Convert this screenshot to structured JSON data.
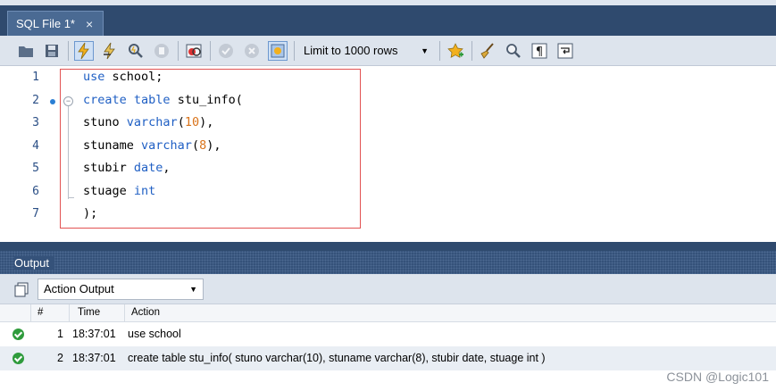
{
  "tab": {
    "title": "SQL File 1*",
    "close": "×"
  },
  "toolbar": {
    "icons": [
      "folder-icon",
      "save-icon",
      "execute-icon",
      "execute-current-icon",
      "explain-icon",
      "stop-icon",
      "toggle-error-icon",
      "commit-icon",
      "rollback-icon",
      "autocommit-icon"
    ],
    "limit_label": "Limit to 1000 rows",
    "limit_arrow": "▼",
    "right_icons": [
      "bookmark-star-icon",
      "beautify-broom-icon",
      "find-icon",
      "invisible-chars-icon",
      "word-wrap-icon"
    ]
  },
  "editor": {
    "lines": [
      {
        "n": "1",
        "tokens": [
          [
            "kw",
            "use"
          ],
          [
            "plain",
            " school;"
          ]
        ]
      },
      {
        "n": "2",
        "tokens": [
          [
            "kw",
            "create"
          ],
          [
            "plain",
            " "
          ],
          [
            "kw",
            "table"
          ],
          [
            "plain",
            " stu_info("
          ]
        ]
      },
      {
        "n": "3",
        "tokens": [
          [
            "plain",
            "stuno "
          ],
          [
            "kw",
            "varchar"
          ],
          [
            "plain",
            "("
          ],
          [
            "num",
            "10"
          ],
          [
            "plain",
            "),"
          ]
        ]
      },
      {
        "n": "4",
        "tokens": [
          [
            "plain",
            "stuname "
          ],
          [
            "kw",
            "varchar"
          ],
          [
            "plain",
            "("
          ],
          [
            "num",
            "8"
          ],
          [
            "plain",
            "),"
          ]
        ]
      },
      {
        "n": "5",
        "tokens": [
          [
            "plain",
            "stubir "
          ],
          [
            "kw",
            "date"
          ],
          [
            "plain",
            ","
          ]
        ]
      },
      {
        "n": "6",
        "tokens": [
          [
            "plain",
            "stuage "
          ],
          [
            "kw",
            "int"
          ]
        ]
      },
      {
        "n": "7",
        "tokens": [
          [
            "plain",
            ");"
          ]
        ]
      }
    ]
  },
  "output": {
    "title": "Output",
    "selector": "Action Output",
    "selector_arrow": "▼",
    "columns": {
      "num": "#",
      "time": "Time",
      "action": "Action"
    },
    "rows": [
      {
        "num": "1",
        "time": "18:37:01",
        "action": "use school"
      },
      {
        "num": "2",
        "time": "18:37:01",
        "action": "create table stu_info( stuno varchar(10), stuname varchar(8), stubir date, stuage int )"
      }
    ]
  },
  "watermark": "CSDN @Logic101",
  "colors": {
    "keyword": "#1f5fc4",
    "number": "#d9731a",
    "highlight": "#e25252",
    "header": "#2f4a6e"
  }
}
